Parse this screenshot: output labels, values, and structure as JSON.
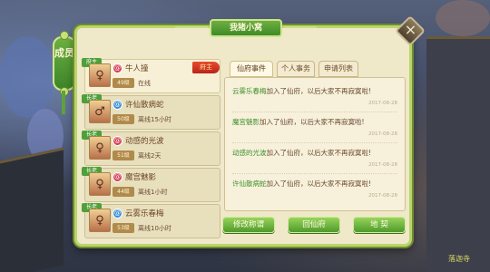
{
  "window": {
    "title": "我猪小窝",
    "close_icon": "close-icon",
    "side_tab_label": "成员"
  },
  "tabs": [
    {
      "label": "仙府事件",
      "active": true
    },
    {
      "label": "个人事务",
      "active": false
    },
    {
      "label": "申请列表",
      "active": false
    }
  ],
  "members": [
    {
      "rank": "府主",
      "name": "牛人撞",
      "level": "49级",
      "status": "在线",
      "owner_badge": "府主",
      "school_color": "#d63b54",
      "avatar": "♀"
    },
    {
      "rank": "长老",
      "name": "许仙散病蛇",
      "level": "50级",
      "status": "离线15小时",
      "school_color": "#3a8fd6",
      "avatar": "♂"
    },
    {
      "rank": "长老",
      "name": "动感的光波",
      "level": "51级",
      "status": "离线2天",
      "school_color": "#d63b54",
      "avatar": "♀"
    },
    {
      "rank": "长老",
      "name": "魔宫魅影",
      "level": "44级",
      "status": "离线1小时",
      "school_color": "#d63b54",
      "avatar": "♀"
    },
    {
      "rank": "长老",
      "name": "云雾乐春梅",
      "level": "53级",
      "status": "离线10小时",
      "school_color": "#3a8fd6",
      "avatar": "♀"
    }
  ],
  "events": [
    {
      "who": "云雾乐春梅",
      "text": "加入了仙府，以后大家不再寂寞啦!",
      "time": "2017-08-28"
    },
    {
      "who": "魔宫魅影",
      "text": "加入了仙府，以后大家不再寂寞啦!",
      "time": "2017-08-28"
    },
    {
      "who": "动感的光波",
      "text": "加入了仙府，以后大家不再寂寞啦!",
      "time": "2017-08-28"
    },
    {
      "who": "许仙散病蛇",
      "text": "加入了仙府，以后大家不再寂寞啦!",
      "time": "2017-08-28"
    }
  ],
  "buttons": {
    "modify_title": "修改称谓",
    "return_home": "回仙府",
    "territory": "地 契"
  },
  "scene": {
    "ground_label": "落迦寺"
  }
}
